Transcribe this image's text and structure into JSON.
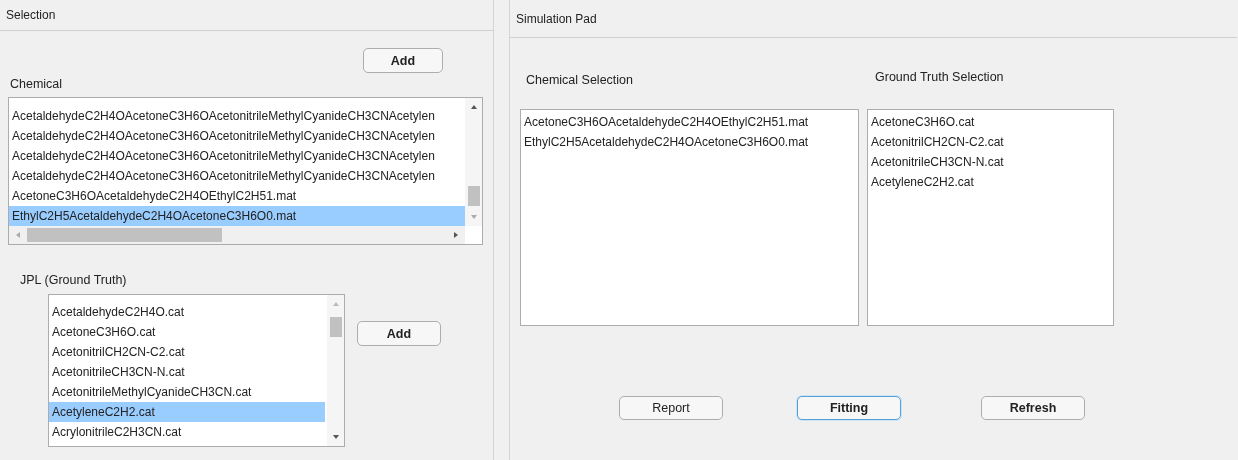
{
  "selection_panel": {
    "title": "Selection",
    "add_button": "Add",
    "chemical": {
      "label": "Chemical",
      "items": [
        {
          "text": "AcetaldehydeC2H4OAcetoneC3H6OAcetonitrileMethylCyanideCH3CNAcetylen",
          "selected": false
        },
        {
          "text": "AcetaldehydeC2H4OAcetoneC3H6OAcetonitrileMethylCyanideCH3CNAcetylen",
          "selected": false
        },
        {
          "text": "AcetaldehydeC2H4OAcetoneC3H6OAcetonitrileMethylCyanideCH3CNAcetylen",
          "selected": false
        },
        {
          "text": "AcetaldehydeC2H4OAcetoneC3H6OAcetonitrileMethylCyanideCH3CNAcetylen",
          "selected": false
        },
        {
          "text": "AcetoneC3H6OAcetaldehydeC2H4OEthylC2H51.mat",
          "selected": false
        },
        {
          "text": "EthylC2H5AcetaldehydeC2H4OAcetoneC3H6O0.mat",
          "selected": true
        }
      ]
    },
    "jpl": {
      "label": "JPL (Ground Truth)",
      "add_button": "Add",
      "items": [
        {
          "text": "AcetaldehydeC2H4O.cat",
          "selected": false
        },
        {
          "text": "AcetoneC3H6O.cat",
          "selected": false
        },
        {
          "text": "AcetonitrilCH2CN-C2.cat",
          "selected": false
        },
        {
          "text": "AcetonitrileCH3CN-N.cat",
          "selected": false
        },
        {
          "text": "AcetonitrileMethylCyanideCH3CN.cat",
          "selected": false
        },
        {
          "text": "AcetyleneC2H2.cat",
          "selected": true
        },
        {
          "text": "AcrylonitrileC2H3CN.cat",
          "selected": false
        }
      ]
    }
  },
  "simulation_pad": {
    "title": "Simulation Pad",
    "chemical_selection": {
      "label": "Chemical Selection",
      "items": [
        "AcetoneC3H6OAcetaldehydeC2H4OEthylC2H51.mat",
        "EthylC2H5AcetaldehydeC2H4OAcetoneC3H6O0.mat"
      ]
    },
    "ground_truth_selection": {
      "label": "Ground Truth Selection",
      "items": [
        "AcetoneC3H6O.cat",
        "AcetonitrilCH2CN-C2.cat",
        "AcetonitrileCH3CN-N.cat",
        "AcetyleneC2H2.cat"
      ]
    },
    "buttons": [
      {
        "label": "Report",
        "focused": false
      },
      {
        "label": "Fitting",
        "focused": true
      },
      {
        "label": "Refresh",
        "focused": false
      }
    ]
  }
}
